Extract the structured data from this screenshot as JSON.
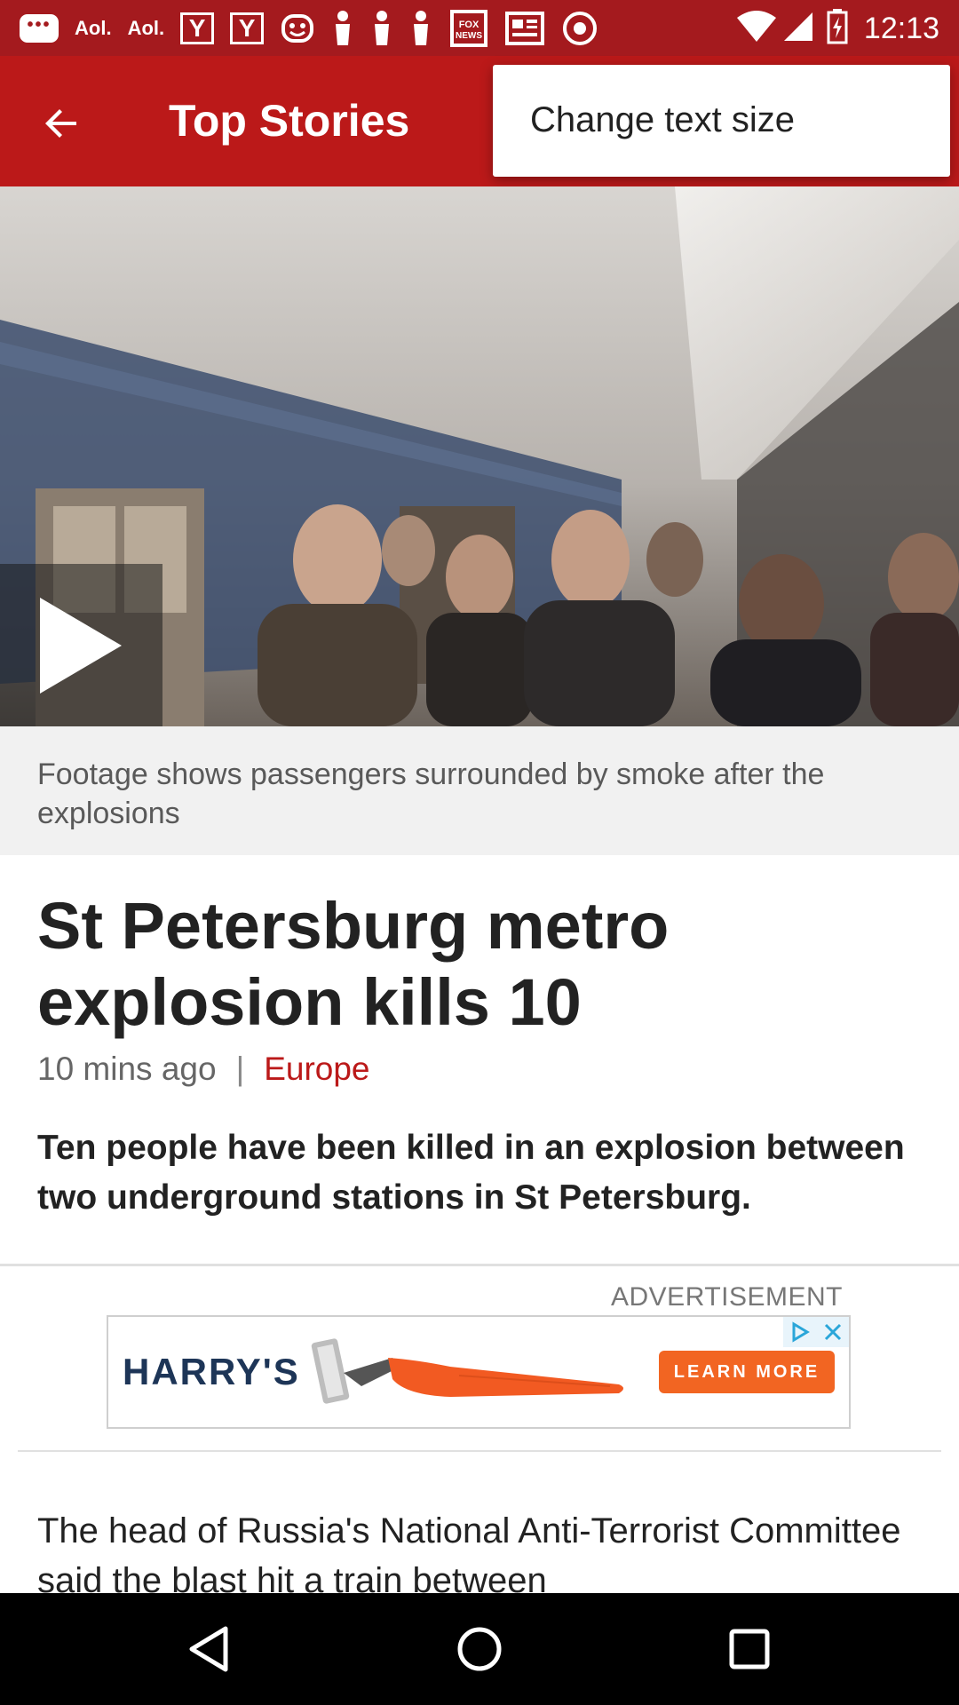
{
  "status_bar": {
    "time": "12:13",
    "icons": [
      "messaging-icon",
      "aol-icon",
      "aol-icon",
      "yahoo-icon",
      "yahoo-icon",
      "happy-face-icon",
      "person-icon",
      "person-icon",
      "person-icon",
      "fox-news-icon",
      "news-icon",
      "eye-icon",
      "wifi-icon",
      "signal-icon",
      "battery-icon"
    ],
    "aol_label": "Aol.",
    "yahoo_label": "Y"
  },
  "app_bar": {
    "title": "Top Stories",
    "back_icon": "arrow-back-icon",
    "color": "#bb1919"
  },
  "menu": {
    "items": [
      "Change text size"
    ]
  },
  "hero": {
    "caption": "Footage shows passengers surrounded by smoke after the explosions",
    "play_icon": "play-icon"
  },
  "article": {
    "headline": "St Petersburg metro explosion kills 10",
    "timestamp": "10 mins ago",
    "separator": "|",
    "section": "Europe",
    "summary": "Ten people have been killed in an explosion between two underground stations in St Petersburg.",
    "body": "The head of Russia's National Anti-Terrorist Committee said the blast hit a train between"
  },
  "ad": {
    "label": "ADVERTISEMENT",
    "brand": "HARRY'S",
    "cta": "LEARN MORE",
    "icons": [
      "ad-choices-icon",
      "close-icon"
    ]
  },
  "nav_bar": {
    "icons": [
      "back-triangle-icon",
      "home-circle-icon",
      "recents-square-icon"
    ]
  }
}
